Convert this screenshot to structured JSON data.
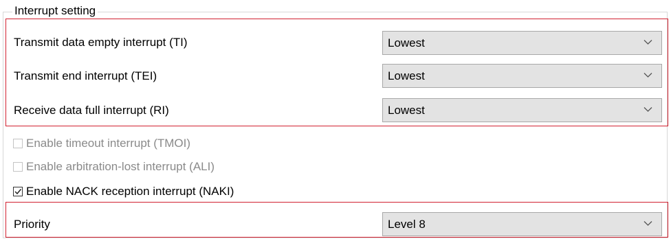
{
  "group": {
    "title": "Interrupt setting"
  },
  "interrupts": [
    {
      "label": "Transmit data empty interrupt (TI)",
      "value": "Lowest"
    },
    {
      "label": "Transmit end interrupt (TEI)",
      "value": "Lowest"
    },
    {
      "label": "Receive data full interrupt (RI)",
      "value": "Lowest"
    }
  ],
  "checkboxes": [
    {
      "label": "Enable timeout interrupt (TMOI)",
      "checked": false,
      "enabled": false
    },
    {
      "label": "Enable arbitration-lost interrupt (ALI)",
      "checked": false,
      "enabled": false
    },
    {
      "label": "Enable NACK reception interrupt (NAKI)",
      "checked": true,
      "enabled": true
    }
  ],
  "priority": {
    "label": "Priority",
    "value": "Level 8"
  },
  "colors": {
    "highlight": "#d1202f",
    "combo_bg": "#e3e3e3",
    "disabled_text": "#8a8a8a"
  },
  "icons": {
    "dropdown": "chevron-down-icon",
    "check": "checkmark-icon"
  }
}
